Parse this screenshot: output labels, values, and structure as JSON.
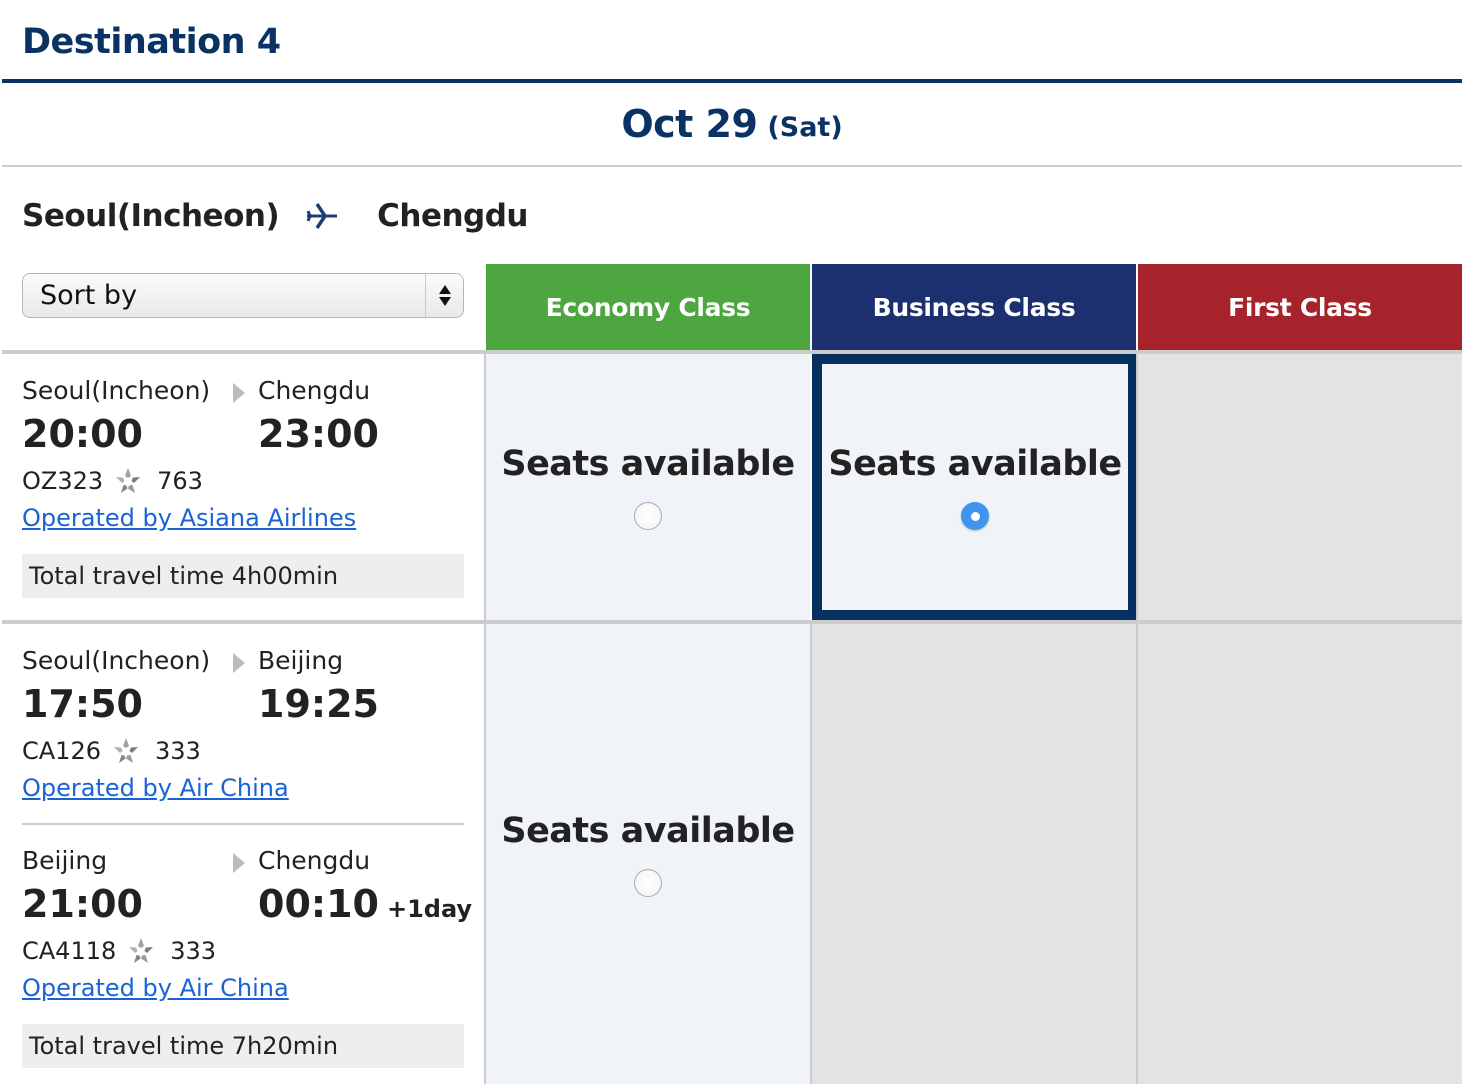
{
  "page": {
    "title": "Destination 4",
    "date": "Oct 29",
    "day": "(Sat)"
  },
  "route": {
    "origin": "Seoul(Incheon)",
    "destination": "Chengdu",
    "icon": "airplane-icon"
  },
  "sort": {
    "label": "Sort by",
    "icon": "select-arrows-icon"
  },
  "classes": [
    {
      "label": "Economy Class",
      "color": "#4da640"
    },
    {
      "label": "Business Class",
      "color": "#1c2f6e"
    },
    {
      "label": "First Class",
      "color": "#a6232c"
    }
  ],
  "colors": {
    "brand_navy": "#0a3263",
    "link": "#1a63d6",
    "radio_selected": "#3d95ee",
    "cell_available": "#f0f3f8",
    "cell_unavailable": "#e2e3e5"
  },
  "flights": [
    {
      "legs": [
        {
          "from": "Seoul(Incheon)",
          "to": "Chengdu",
          "departure": "20:00",
          "arrival": "23:00",
          "arrival_offset": "",
          "flight_no": "OZ323",
          "alliance_icon": "star-alliance-icon",
          "aircraft": "763",
          "operated_by": "Operated by Asiana Airlines"
        }
      ],
      "total_time": "Total travel time 4h00min",
      "availability": [
        {
          "class": "Economy Class",
          "text": "Seats available",
          "selected": false
        },
        {
          "class": "Business Class",
          "text": "Seats available",
          "selected": true
        },
        {
          "class": "First Class",
          "text": "",
          "selected": false
        }
      ]
    },
    {
      "legs": [
        {
          "from": "Seoul(Incheon)",
          "to": "Beijing",
          "departure": "17:50",
          "arrival": "19:25",
          "arrival_offset": "",
          "flight_no": "CA126",
          "alliance_icon": "star-alliance-icon",
          "aircraft": "333",
          "operated_by": "Operated by Air China"
        },
        {
          "from": "Beijing",
          "to": "Chengdu",
          "departure": "21:00",
          "arrival": "00:10",
          "arrival_offset": "+1day",
          "flight_no": "CA4118",
          "alliance_icon": "star-alliance-icon",
          "aircraft": "333",
          "operated_by": "Operated by Air China"
        }
      ],
      "total_time": "Total travel time 7h20min",
      "availability": [
        {
          "class": "Economy Class",
          "text": "Seats available",
          "selected": false
        },
        {
          "class": "Business Class",
          "text": "",
          "selected": false
        },
        {
          "class": "First Class",
          "text": "",
          "selected": false
        }
      ]
    }
  ]
}
